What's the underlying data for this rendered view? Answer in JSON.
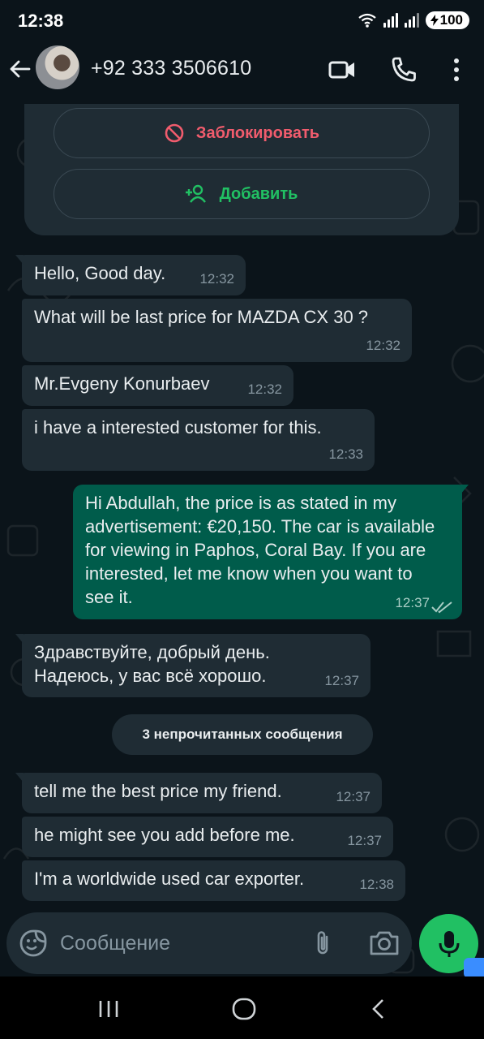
{
  "status_bar": {
    "time": "12:38",
    "battery": "100"
  },
  "header": {
    "contact": "+92 333 3506610"
  },
  "card": {
    "block_label": "Заблокировать",
    "add_label": "Добавить"
  },
  "messages": [
    {
      "dir": "in",
      "text": "Hello, Good day.",
      "time": "12:32"
    },
    {
      "dir": "in",
      "text": "What will be last price for MAZDA CX 30 ?",
      "time": "12:32"
    },
    {
      "dir": "in",
      "text": "Mr.Evgeny Konurbaev",
      "time": "12:32"
    },
    {
      "dir": "in",
      "text": "i have a interested customer for this.",
      "time": "12:33"
    },
    {
      "dir": "out",
      "text": "Hi Abdullah, the price is as stated in my advertisement: €20,150. The car is available for viewing in Paphos, Coral Bay. If you are interested, let me know when you want to see it.",
      "time": "12:37",
      "status": "read"
    },
    {
      "dir": "in",
      "text": "Здравствуйте, добрый день. Надеюсь, у вас всё хорошо.",
      "time": "12:37"
    },
    {
      "dir": "in",
      "text": "tell me the best price my friend.",
      "time": "12:37"
    },
    {
      "dir": "in",
      "text": "he might see you add before me.",
      "time": "12:37"
    },
    {
      "dir": "in",
      "text": "I'm a worldwide used car exporter.",
      "time": "12:38"
    }
  ],
  "unread_divider": "3 непрочитанных сообщения",
  "composer": {
    "placeholder": "Сообщение"
  },
  "colors": {
    "background": "#0b141a",
    "incoming": "#1f2c34",
    "outgoing": "#005c4b",
    "accent": "#21c063",
    "danger": "#f15c6d"
  }
}
